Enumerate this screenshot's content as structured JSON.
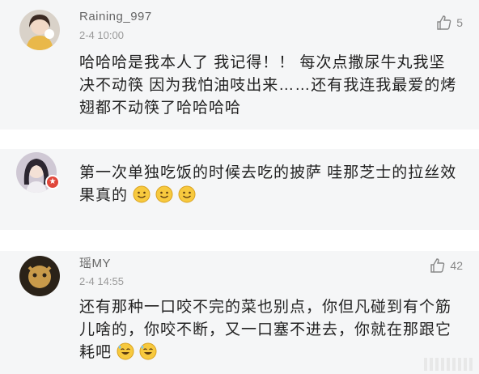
{
  "comments": [
    {
      "username": "Raining_997",
      "time": "2-4 10:00",
      "likes": "5",
      "text": "哈哈哈是我本人了 我记得！！ 每次点撒尿牛丸我坚决不动筷 因为我怕油吱出来……还有我连我最爱的烤翅都不动筷了哈哈哈哈"
    },
    {
      "username": "",
      "time": "",
      "likes": "",
      "text": "第一次单独吃饭的时候去吃的披萨  哇那芝士的拉丝效果真的"
    },
    {
      "username": "瑶MY",
      "time": "2-4 14:55",
      "likes": "42",
      "text": "还有那种一口咬不完的菜也别点，你但凡碰到有个筋儿啥的，你咬不断，又一口塞不进去，你就在那跟它耗吧"
    }
  ],
  "icons": {
    "like": "thumbs-up-icon",
    "smile": "smile-emoji-icon",
    "sweat": "sweat-laugh-emoji-icon",
    "badge": "verified-badge-icon"
  },
  "colors": {
    "card_bg": "#f5f6f7",
    "text": "#222222",
    "meta": "#999999",
    "badge": "#e0473b"
  }
}
